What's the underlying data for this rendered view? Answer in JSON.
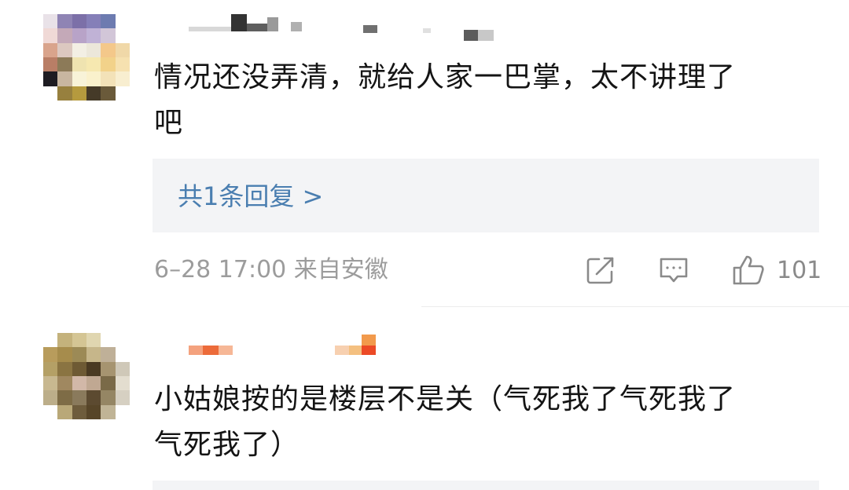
{
  "comments": [
    {
      "text_line1": "情况还没弄清，就给人家一巴掌，太不讲理了",
      "text_line2": "吧",
      "reply_link": "共1条回复 >",
      "meta": "6–28 17:00 来自安徽",
      "like_count": "101",
      "icons": [
        "share-icon",
        "comment-icon",
        "thumbs-up-icon"
      ],
      "colors": {
        "link": "#4a7eb0",
        "meta": "#9c9c9c",
        "reply_bg": "#f3f4f6"
      }
    },
    {
      "text_line1": "小姑娘按的是楼层不是关（气死我了气死我了",
      "text_line2": "气死我了）"
    }
  ]
}
